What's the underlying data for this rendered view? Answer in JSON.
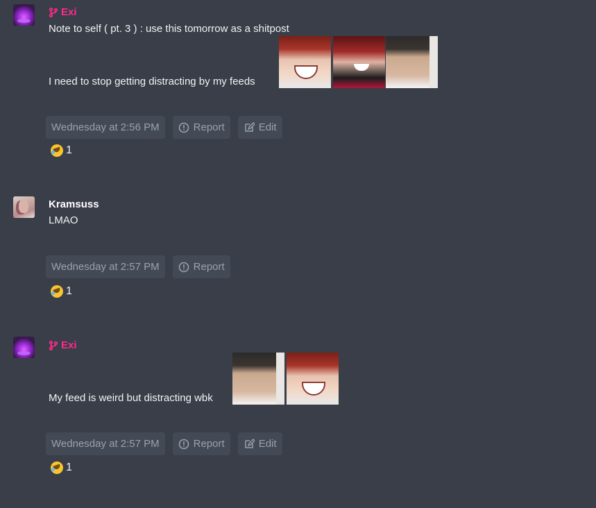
{
  "messages": [
    {
      "author": "Exi",
      "lines": [
        "Note to self ( pt. 3 ) : use this tomorrow as a shitpost",
        "I need to stop getting distracting by my feeds"
      ],
      "timestamp": "Wednesday at 2:56 PM",
      "report_label": "Report",
      "edit_label": "Edit",
      "reaction_count": "1"
    },
    {
      "author": "Kramsuss",
      "lines": [
        "LMAO"
      ],
      "timestamp": "Wednesday at 2:57 PM",
      "report_label": "Report",
      "reaction_count": "1"
    },
    {
      "author": "Exi",
      "lines": [
        "My feed is weird but distracting wbk"
      ],
      "timestamp": "Wednesday at 2:57 PM",
      "report_label": "Report",
      "edit_label": "Edit",
      "reaction_count": "1"
    }
  ],
  "colors": {
    "background": "#393e48",
    "exi_name": "#ff2a8f",
    "chip_bg": "#444a55",
    "chip_text": "#9aa1ad"
  }
}
